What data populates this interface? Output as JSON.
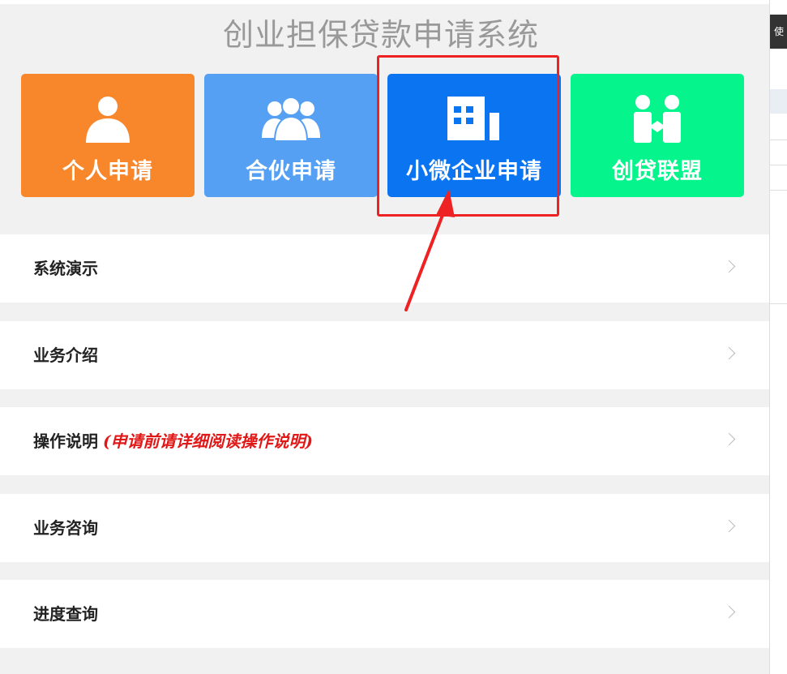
{
  "app": {
    "title": "创业担保贷款申请系统"
  },
  "tiles": [
    {
      "label": "个人申请",
      "icon": "person-icon",
      "color": "#f8862a"
    },
    {
      "label": "合伙申请",
      "icon": "group-icon",
      "color": "#56a0f3"
    },
    {
      "label": "小微企业申请",
      "icon": "building-icon",
      "color": "#0b74f1"
    },
    {
      "label": "创贷联盟",
      "icon": "handshake-icon",
      "color": "#06f48c"
    }
  ],
  "menu": [
    {
      "label": "系统演示",
      "note": ""
    },
    {
      "label": "业务介绍",
      "note": ""
    },
    {
      "label": "操作说明",
      "note": "(申请前请详细阅读操作说明)"
    },
    {
      "label": "业务咨询",
      "note": ""
    },
    {
      "label": "进度查询",
      "note": ""
    }
  ],
  "side_strip": {
    "tab_label": "使"
  },
  "colors": {
    "page_bg": "#f1f1f1",
    "title": "#999999",
    "annotation": "#ee2222",
    "note_text": "#e01818"
  }
}
